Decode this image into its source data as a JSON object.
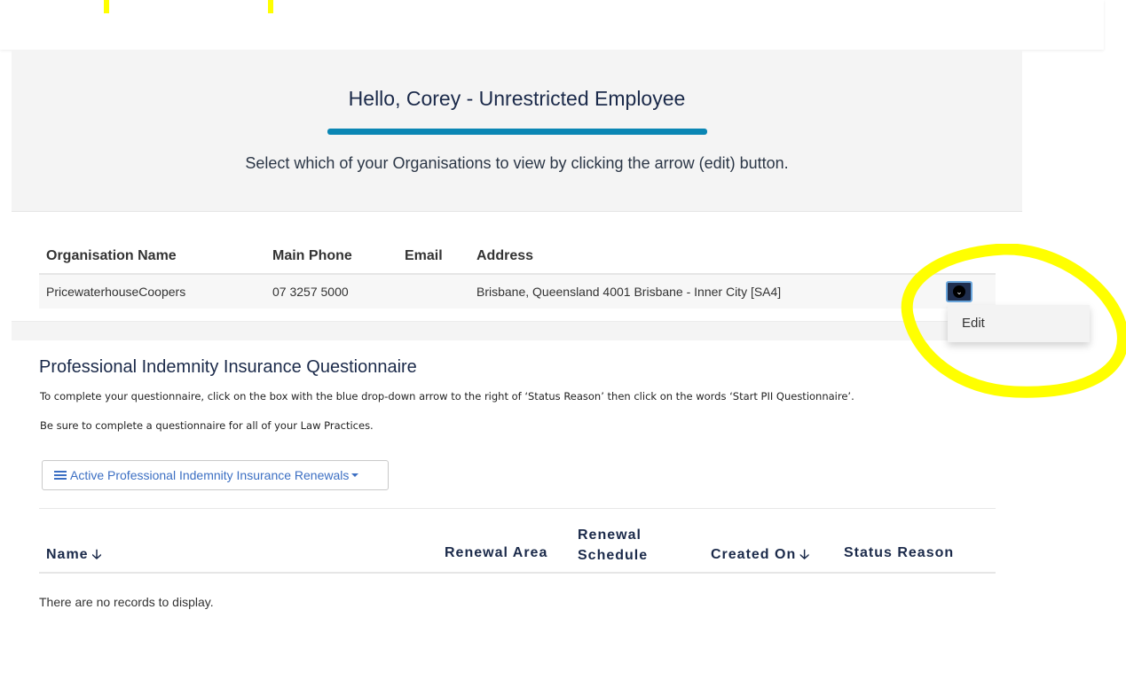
{
  "hero": {
    "title": "Hello, Corey - Unrestricted Employee",
    "subtitle": "Select which of your Organisations to view by clicking the arrow (edit) button."
  },
  "org_table": {
    "headers": [
      "Organisation Name",
      "Main Phone",
      "Email",
      "Address"
    ],
    "rows": [
      {
        "name": "PricewaterhouseCoopers",
        "phone": "07 3257 5000",
        "email": "",
        "address": "Brisbane, Queensland 4001 Brisbane - Inner City [SA4]"
      }
    ],
    "row_action_icon": "chevron-down-icon"
  },
  "row_menu": {
    "items": [
      "Edit"
    ]
  },
  "annotation": {
    "color": "#ffff00"
  },
  "pii": {
    "title": "Professional Indemnity Insurance Questionnaire",
    "instruction_1": "To complete your questionnaire, click on the box with the blue drop-down arrow to the right of ‘Status Reason’ then click on the words ‘Start PII Questionnaire’.",
    "instruction_2": "Be sure to complete a questionnaire for all of your Law Practices.",
    "view_selector": "Active Professional Indemnity Insurance Renewals",
    "columns": [
      "Name",
      "Renewal Area",
      "Renewal Schedule",
      "Created On",
      "Status Reason"
    ],
    "sort_icon": "arrow-down-icon",
    "empty_message": "There are no records to display."
  },
  "colors": {
    "accent_bar": "#0a86b4",
    "heading": "#1b2a4a",
    "link": "#3c6fc3",
    "action_button": "#1f2e4e"
  }
}
